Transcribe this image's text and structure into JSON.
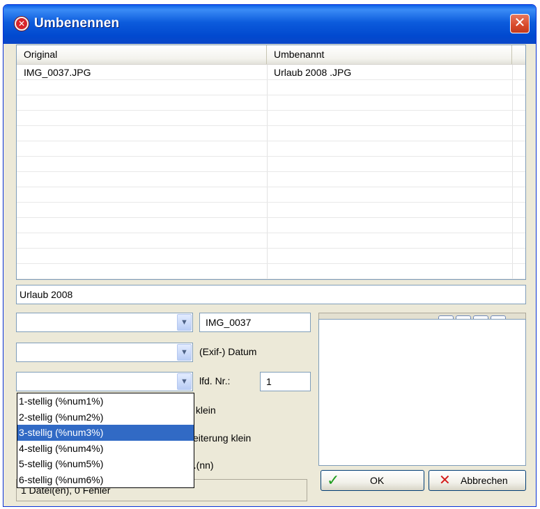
{
  "window": {
    "title": "Umbenennen",
    "close_glyph": "✕",
    "icon": "app-logo-icon"
  },
  "grid": {
    "columns": [
      "Original",
      "Umbenannt"
    ],
    "rows": [
      {
        "original": "IMG_0037.JPG",
        "renamed": "Urlaub 2008 .JPG"
      }
    ]
  },
  "pattern": {
    "value": "Urlaub 2008"
  },
  "options": {
    "combo1": {
      "value": "",
      "side_value": "IMG_0037"
    },
    "combo2": {
      "value": "",
      "side_label": "(Exif-) Datum"
    },
    "combo3": {
      "value": "",
      "side_label": "lfd. Nr.:",
      "side_value": "1"
    },
    "hidden_labels": [
      "s klein",
      "veiterung klein",
      "...(nn)"
    ]
  },
  "dropdown": {
    "items": [
      "1-stellig (%num1%)",
      "2-stellig (%num2%)",
      "3-stellig (%num3%)",
      "4-stellig (%num4%)",
      "5-stellig (%num5%)",
      "6-stellig (%num6%)"
    ],
    "selected_index": 2
  },
  "tools": {
    "open_icon": "folder-open-icon",
    "delete_icon": "delete-icon",
    "up_icon": "arrow-up-icon",
    "down_icon": "arrow-down-icon"
  },
  "buttons": {
    "ok": "OK",
    "cancel": "Abbrechen"
  },
  "status": "1 Datei(en), 0 Fehler",
  "colors": {
    "title_bar": "#0a5fe8",
    "selection": "#316ac5",
    "window_bg": "#ece9d8"
  }
}
